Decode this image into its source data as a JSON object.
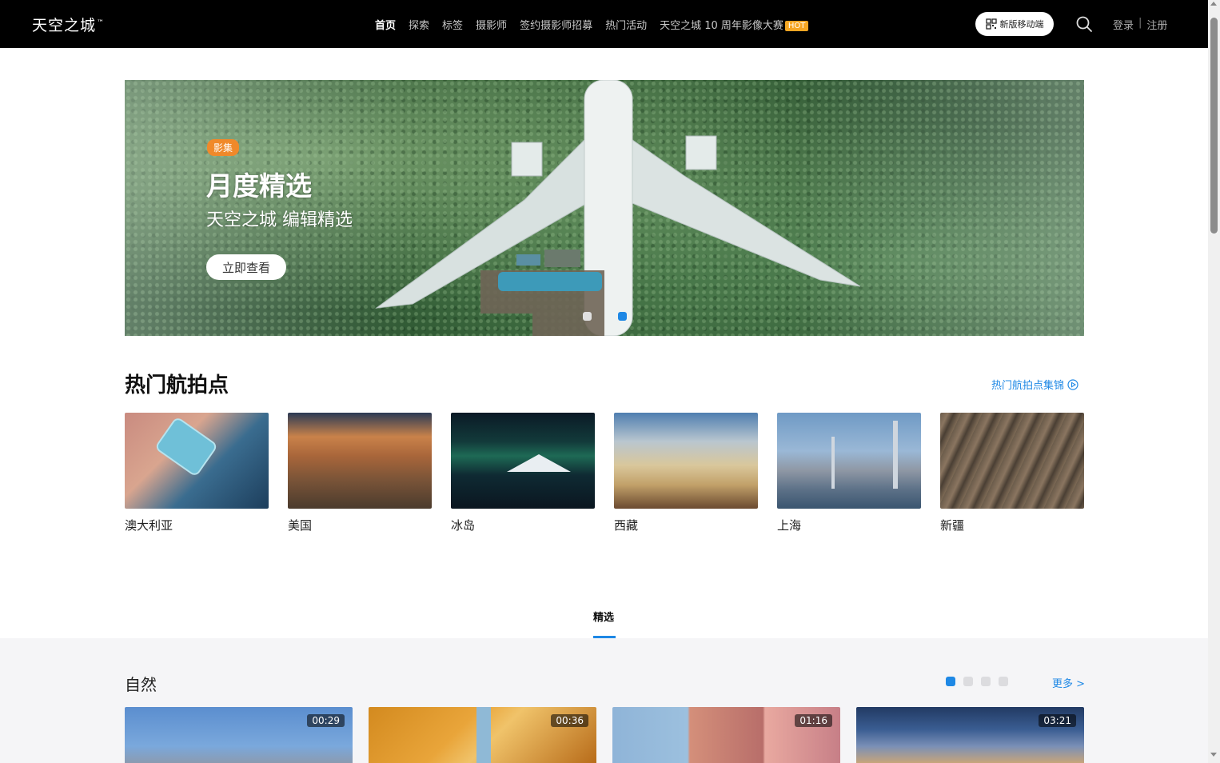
{
  "header": {
    "logo": "天空之城",
    "logo_tm": "™",
    "nav": [
      {
        "label": "首页"
      },
      {
        "label": "探索"
      },
      {
        "label": "标签"
      },
      {
        "label": "摄影师"
      },
      {
        "label": "签约摄影师招募"
      },
      {
        "label": "热门活动"
      },
      {
        "label": "天空之城 10 周年影像大赛"
      }
    ],
    "hot_badge": "HOT",
    "mobile_button": "新版移动端",
    "login": "登录",
    "separator": "|",
    "register": "注册"
  },
  "banner": {
    "tag": "影集",
    "title": "月度精选",
    "subtitle": "天空之城 编辑精选",
    "cta": "立即查看",
    "slide_count": 2,
    "active_slide": 2
  },
  "hot_spots": {
    "title": "热门航拍点",
    "link": "热门航拍点集锦",
    "items": [
      {
        "label": "澳大利亚"
      },
      {
        "label": "美国"
      },
      {
        "label": "冰岛"
      },
      {
        "label": "西藏"
      },
      {
        "label": "上海"
      },
      {
        "label": "新疆"
      }
    ]
  },
  "tabs": {
    "active": "精选"
  },
  "category": {
    "title": "自然",
    "more": "更多 >",
    "page_count": 4,
    "active_page": 1,
    "videos": [
      {
        "duration": "00:29"
      },
      {
        "duration": "00:36"
      },
      {
        "duration": "01:16"
      },
      {
        "duration": "03:21"
      }
    ]
  },
  "colors": {
    "accent": "#1e88e5",
    "hot_badge": "#f5a623",
    "tag_badge": "#f0892a",
    "topbar": "#000000"
  }
}
